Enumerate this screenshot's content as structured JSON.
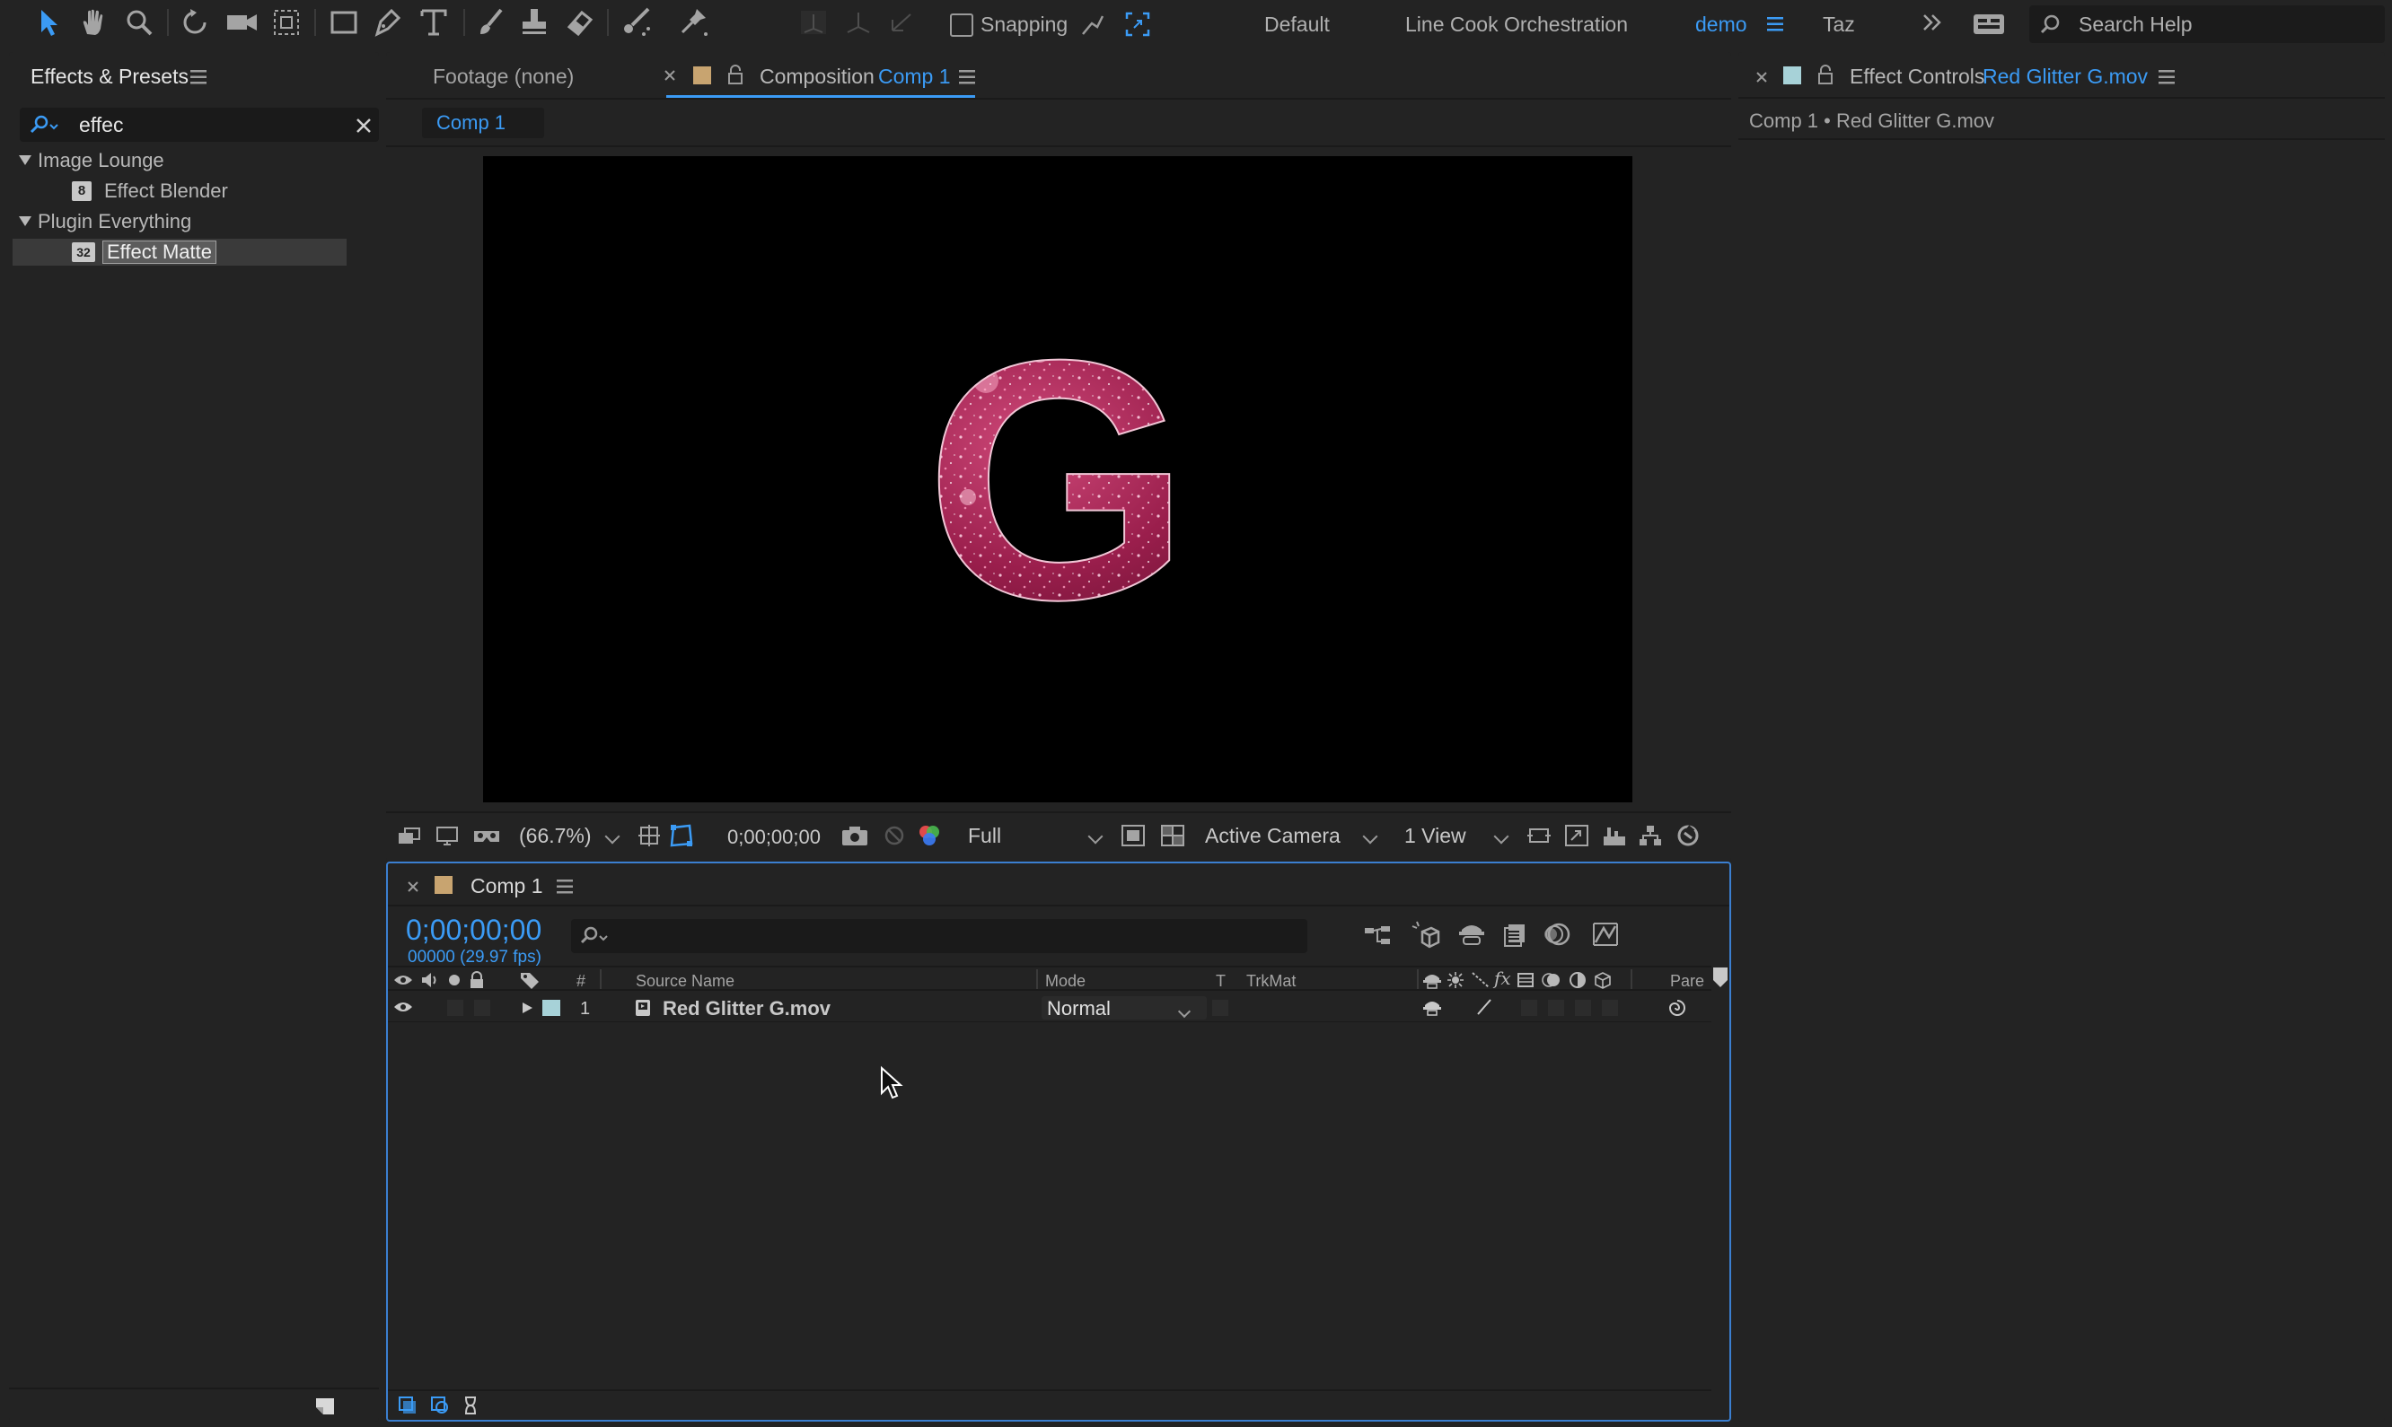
{
  "toolbar": {
    "snapping_label": "Snapping",
    "workspaces": [
      "Default",
      "Line Cook Orchestration",
      "demo",
      "Taz"
    ],
    "active_workspace_index": 2,
    "search_placeholder": "Search Help",
    "accent_color": "#3b9bf5"
  },
  "effects_panel": {
    "title": "Effects & Presets",
    "search_value": "effec",
    "groups": [
      {
        "label": "Image Lounge",
        "items": [
          {
            "label": "Effect Blender",
            "badge": "8"
          }
        ]
      },
      {
        "label": "Plugin Everything",
        "items": [
          {
            "label": "Effect Matte",
            "badge": "32",
            "selected": true
          }
        ]
      }
    ]
  },
  "viewer": {
    "tabs": {
      "footage": "Footage (none)",
      "composition_prefix": "Composition",
      "composition_name": "Comp 1"
    },
    "breadcrumb": "Comp 1",
    "preview_glyph": "G",
    "controls": {
      "zoom": "(66.7%)",
      "timecode": "0;00;00;00",
      "resolution": "Full",
      "camera": "Active Camera",
      "views": "1 View"
    }
  },
  "effect_controls": {
    "tab_prefix": "Effect Controls",
    "tab_layer": "Red Glitter G.mov",
    "subtitle": "Comp 1 • Red Glitter G.mov"
  },
  "timeline": {
    "tab": "Comp 1",
    "timecode": "0;00;00;00",
    "frame_info": "00000 (29.97 fps)",
    "columns": {
      "number": "#",
      "source_name": "Source Name",
      "mode": "Mode",
      "t": "T",
      "trkmat": "TrkMat",
      "parent": "Pare"
    },
    "layers": [
      {
        "number": "1",
        "name": "Red Glitter G.mov",
        "mode": "Normal",
        "label_color": "#a7d2d8"
      }
    ]
  }
}
